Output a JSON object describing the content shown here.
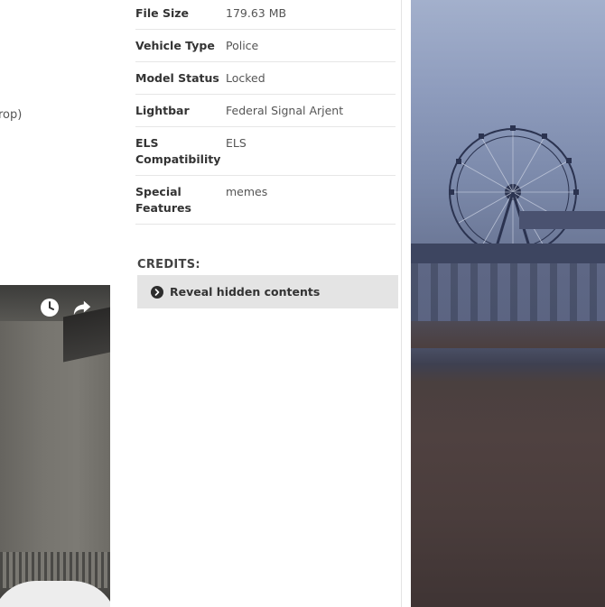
{
  "left": {
    "partial_text": "rop)"
  },
  "video": {
    "watch_later_icon": "clock-icon",
    "share_icon": "share-arrow-icon"
  },
  "info": {
    "rows": [
      {
        "key": "File Size",
        "value": "179.63 MB"
      },
      {
        "key": "Vehicle Type",
        "value": "Police"
      },
      {
        "key": "Model Status",
        "value": "Locked"
      },
      {
        "key": "Lightbar",
        "value": "Federal Signal Arjent"
      },
      {
        "key": "ELS Compatibility",
        "value": "ELS"
      },
      {
        "key": "Special Features",
        "value": "memes"
      }
    ]
  },
  "credits": {
    "label": "CREDITS:",
    "reveal_label": "Reveal hidden contents",
    "reveal_icon": "chevron-right-circle-icon"
  },
  "colors": {
    "reveal_bg": "#e4e4e4",
    "text_dark": "#333333",
    "divider": "#e6e6e6"
  }
}
